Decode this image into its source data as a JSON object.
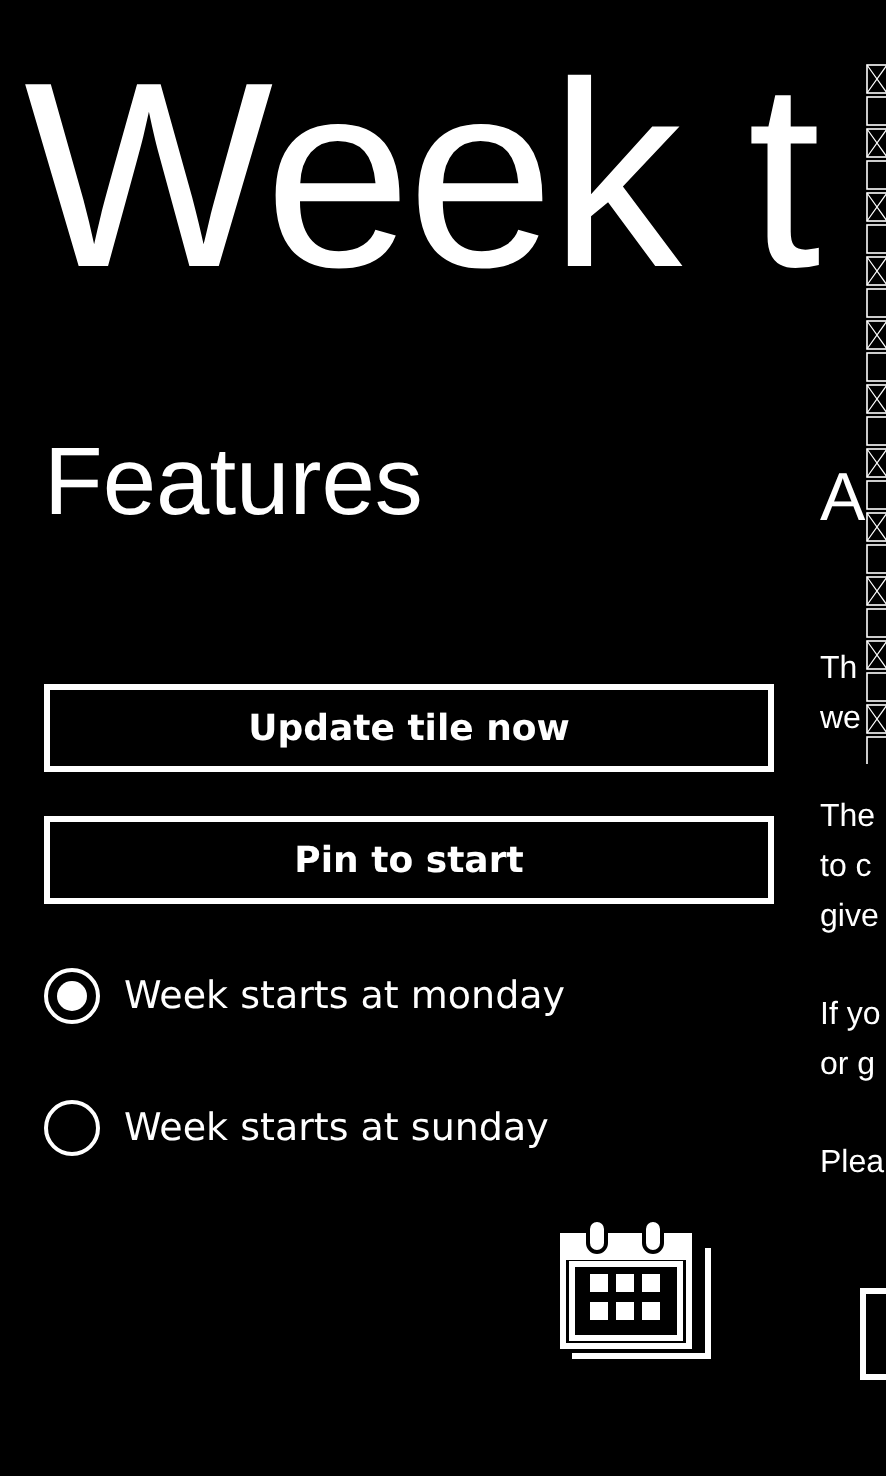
{
  "title": "Week t",
  "features": {
    "header": "Features",
    "buttons": [
      "Update tile now",
      "Pin to start"
    ],
    "options": [
      {
        "label": "Week starts at monday",
        "selected": true
      },
      {
        "label": "Week starts at sunday",
        "selected": false
      }
    ]
  },
  "about": {
    "header": "A",
    "paragraphs": [
      [
        "Th",
        "we"
      ],
      [
        "The",
        "to c",
        "give"
      ],
      [
        "If yo",
        "or g"
      ],
      [
        "Plea"
      ]
    ]
  }
}
